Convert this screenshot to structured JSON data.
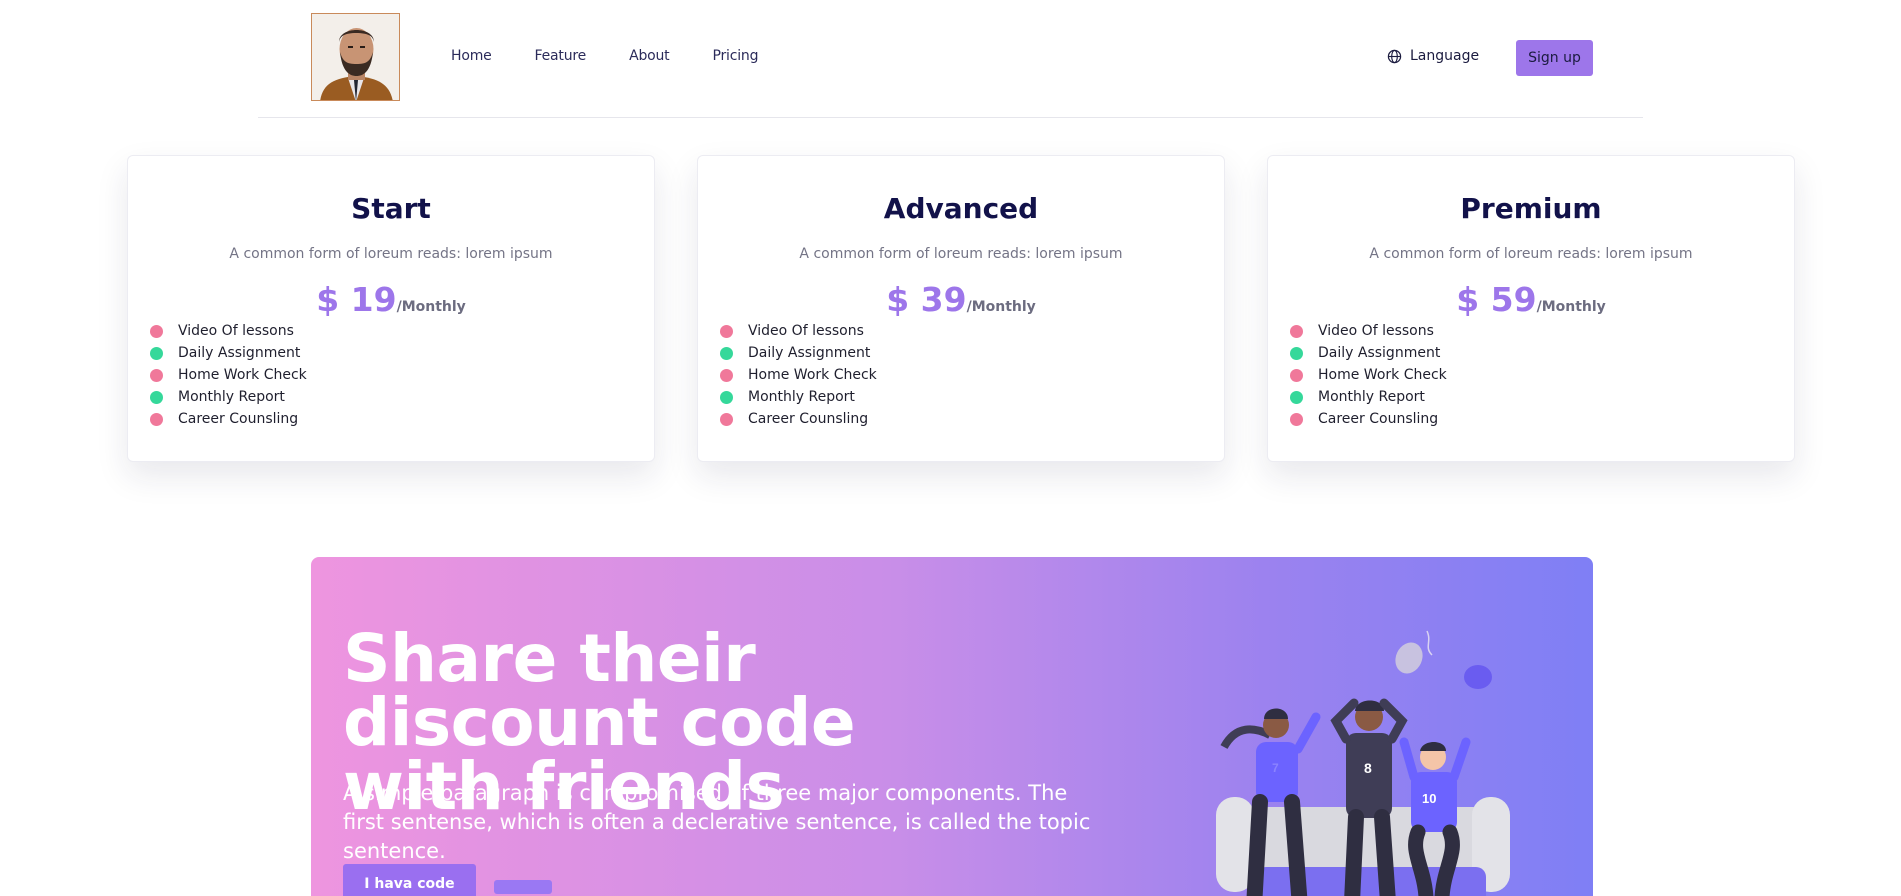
{
  "header": {
    "nav": [
      "Home",
      "Feature",
      "About",
      "Pricing"
    ],
    "language_label": "Language",
    "signup_label": "Sign up"
  },
  "pricing": {
    "cards": [
      {
        "plan": "Start",
        "subtitle": "A common form of loreum reads: lorem ipsum",
        "price": "$ 19",
        "period": "/Monthly",
        "features": [
          "Video Of lessons",
          "Daily Assignment",
          "Home Work Check",
          "Monthly Report",
          "Career Counsling"
        ]
      },
      {
        "plan": "Advanced",
        "subtitle": "A common form of loreum reads: lorem ipsum",
        "price": "$ 39",
        "period": "/Monthly",
        "features": [
          "Video Of lessons",
          "Daily Assignment",
          "Home Work Check",
          "Monthly Report",
          "Career Counsling"
        ]
      },
      {
        "plan": "Premium",
        "subtitle": "A common form of loreum reads: lorem ipsum",
        "price": "$ 59",
        "period": "/Monthly",
        "features": [
          "Video Of lessons",
          "Daily Assignment",
          "Home Work Check",
          "Monthly Report",
          "Career Counsling"
        ]
      }
    ],
    "feature_dot_colors": [
      "#f0789a",
      "#35d89a",
      "#f0789a",
      "#35d89a",
      "#f0789a"
    ]
  },
  "promo": {
    "headline": "Share their discount code with friends",
    "paragraph": "A simple paragraph is compromised of three major components. The first sentense, which is often a declerative sentence, is called the topic sentence.",
    "code_button_label": "I hava code",
    "jersey_numbers": [
      "7",
      "8",
      "10"
    ]
  },
  "colors": {
    "accent": "#9d76ea",
    "plan_title": "#12124a",
    "banner_gradient": [
      "#ee95df",
      "#7f7ff5"
    ]
  }
}
